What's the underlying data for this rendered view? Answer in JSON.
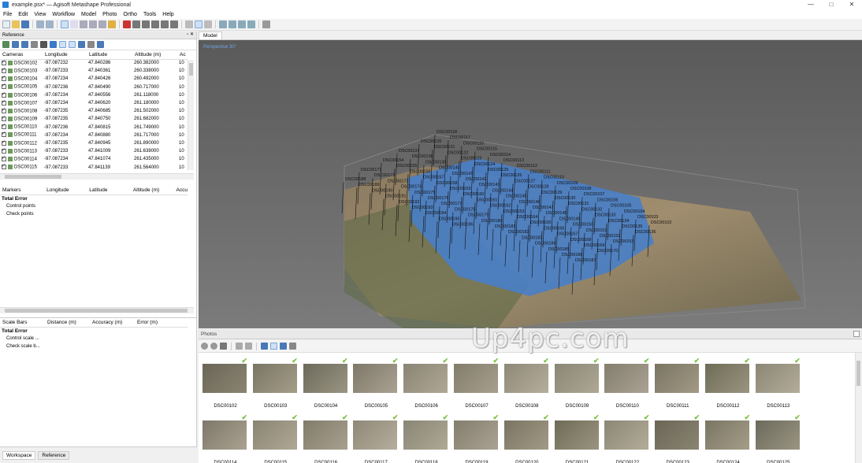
{
  "window": {
    "title": "example.psx* — Agisoft Metashape Professional",
    "min": "—",
    "max": "□",
    "close": "✕"
  },
  "menu": [
    "File",
    "Edit",
    "View",
    "Workflow",
    "Model",
    "Photo",
    "Ortho",
    "Tools",
    "Help"
  ],
  "reference": {
    "panel_title": "Reference",
    "columns": [
      "Cameras",
      "Longitude",
      "Latitude",
      "Altitude (m)",
      "Ac"
    ],
    "rows": [
      {
        "cam": "DSC00102",
        "lon": "-97.087232",
        "lat": "47.840286",
        "alt": "260.382000",
        "acc": "10"
      },
      {
        "cam": "DSC00103",
        "lon": "-97.087233",
        "lat": "47.840361",
        "alt": "260.338000",
        "acc": "10"
      },
      {
        "cam": "DSC00104",
        "lon": "-97.087234",
        "lat": "47.840426",
        "alt": "260.492000",
        "acc": "10"
      },
      {
        "cam": "DSC00105",
        "lon": "-97.087236",
        "lat": "47.840490",
        "alt": "260.717000",
        "acc": "10"
      },
      {
        "cam": "DSC00106",
        "lon": "-97.087234",
        "lat": "47.840556",
        "alt": "261.118000",
        "acc": "10"
      },
      {
        "cam": "DSC00107",
        "lon": "-97.087234",
        "lat": "47.840620",
        "alt": "261.180000",
        "acc": "10"
      },
      {
        "cam": "DSC00108",
        "lon": "-97.087235",
        "lat": "47.840685",
        "alt": "261.502000",
        "acc": "10"
      },
      {
        "cam": "DSC00109",
        "lon": "-97.087235",
        "lat": "47.840750",
        "alt": "261.682000",
        "acc": "10"
      },
      {
        "cam": "DSC00110",
        "lon": "-97.087236",
        "lat": "47.840815",
        "alt": "261.749000",
        "acc": "10"
      },
      {
        "cam": "DSC00111",
        "lon": "-97.087234",
        "lat": "47.840880",
        "alt": "261.717000",
        "acc": "10"
      },
      {
        "cam": "DSC00112",
        "lon": "-97.087235",
        "lat": "47.840945",
        "alt": "261.890000",
        "acc": "10"
      },
      {
        "cam": "DSC00113",
        "lon": "-97.087233",
        "lat": "47.841009",
        "alt": "261.638000",
        "acc": "10"
      },
      {
        "cam": "DSC00114",
        "lon": "-97.087234",
        "lat": "47.841074",
        "alt": "261.435000",
        "acc": "10"
      },
      {
        "cam": "DSC00115",
        "lon": "-97.087233",
        "lat": "47.841139",
        "alt": "261.564000",
        "acc": "10"
      }
    ],
    "markers_columns": [
      "Markers",
      "Longitude",
      "Latitude",
      "Altitude (m)",
      "Accu"
    ],
    "markers_rows": [
      "Total Error",
      "Control points",
      "Check points"
    ],
    "scalebars_columns": [
      "Scale Bars",
      "Distance (m)",
      "Accuracy (m)",
      "Error (m)"
    ],
    "scalebars_rows": [
      "Total Error",
      "Control scale ...",
      "Check scale b..."
    ]
  },
  "bottom_tabs": [
    "Workspace",
    "Reference"
  ],
  "model": {
    "tab": "Model",
    "view_label": "Perspective 30°"
  },
  "photos": {
    "panel_title": "Photos",
    "row1": [
      "DSC00102",
      "DSC00103",
      "DSC00104",
      "DSC00105",
      "DSC00106",
      "DSC00107",
      "DSC00108",
      "DSC00109",
      "DSC00110",
      "DSC00111",
      "DSC00112",
      "DSC00113"
    ],
    "row2": [
      "DSC00114",
      "DSC00115",
      "DSC00116",
      "DSC00117",
      "DSC00118",
      "DSC00119",
      "DSC00120",
      "DSC00121",
      "DSC00122",
      "DSC00123",
      "DSC00124",
      "DSC00125"
    ]
  },
  "watermark": "Up4pc.com",
  "camera_labels": [
    "DSC00118",
    "DSC00117",
    "DSC00116",
    "DSC00115",
    "DSC00114",
    "DSC00113",
    "DSC00112",
    "DSC00111",
    "DSC00110",
    "DSC00109",
    "DSC00108",
    "DSC00107",
    "DSC00106",
    "DSC00105",
    "DSC00104",
    "DSC00103",
    "DSC00102",
    "DSC00120",
    "DSC00121",
    "DSC00122",
    "DSC00123",
    "DSC00124",
    "DSC00125",
    "DSC00126",
    "DSC00127",
    "DSC00128",
    "DSC00129",
    "DSC00130",
    "DSC00131",
    "DSC00132",
    "DSC00133",
    "DSC00134",
    "DSC00135",
    "DSC00136",
    "DSC00137",
    "DSC00138",
    "DSC00139",
    "DSC00140",
    "DSC00141",
    "DSC00142",
    "DSC00143",
    "DSC00144",
    "DSC00145",
    "DSC00146",
    "DSC00147",
    "DSC00148",
    "DSC00149",
    "DSC00150",
    "DSC00151",
    "DSC00152",
    "DSC00153",
    "DSC00154",
    "DSC00155",
    "DSC00156",
    "DSC00157",
    "DSC00158",
    "DSC00159",
    "DSC00160",
    "DSC00161",
    "DSC00162",
    "DSC00163",
    "DSC00164",
    "DSC00165",
    "DSC00166",
    "DSC00167",
    "DSC00168",
    "DSC00169",
    "DSC00170",
    "DSC00171",
    "DSC00172",
    "DSC00173",
    "DSC00174",
    "DSC00175",
    "DSC00176",
    "DSC00177",
    "DSC00178",
    "DSC00179",
    "DSC00180",
    "DSC00181",
    "DSC00182",
    "DSC00183",
    "DSC00184",
    "DSC00185",
    "DSC00186",
    "DSC00187",
    "DSC00188",
    "DSC00189",
    "DSC00190",
    "DSC00191",
    "DSC00192",
    "DSC00193",
    "DSC00194",
    "DSC00195",
    "DSC00196"
  ],
  "colors": {
    "accent": "#2a7fd4",
    "sparse_cloud": "#4a7fc6",
    "check": "#7bc043"
  }
}
